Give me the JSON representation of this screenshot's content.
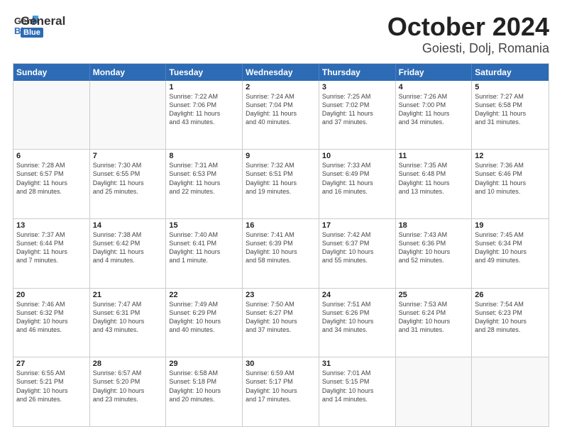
{
  "logo": {
    "text_general": "General",
    "text_blue": "Blue"
  },
  "title": "October 2024",
  "subtitle": "Goiesti, Dolj, Romania",
  "header_days": [
    "Sunday",
    "Monday",
    "Tuesday",
    "Wednesday",
    "Thursday",
    "Friday",
    "Saturday"
  ],
  "rows": [
    [
      {
        "day": "",
        "lines": [],
        "empty": true
      },
      {
        "day": "",
        "lines": [],
        "empty": true
      },
      {
        "day": "1",
        "lines": [
          "Sunrise: 7:22 AM",
          "Sunset: 7:06 PM",
          "Daylight: 11 hours",
          "and 43 minutes."
        ]
      },
      {
        "day": "2",
        "lines": [
          "Sunrise: 7:24 AM",
          "Sunset: 7:04 PM",
          "Daylight: 11 hours",
          "and 40 minutes."
        ]
      },
      {
        "day": "3",
        "lines": [
          "Sunrise: 7:25 AM",
          "Sunset: 7:02 PM",
          "Daylight: 11 hours",
          "and 37 minutes."
        ]
      },
      {
        "day": "4",
        "lines": [
          "Sunrise: 7:26 AM",
          "Sunset: 7:00 PM",
          "Daylight: 11 hours",
          "and 34 minutes."
        ]
      },
      {
        "day": "5",
        "lines": [
          "Sunrise: 7:27 AM",
          "Sunset: 6:58 PM",
          "Daylight: 11 hours",
          "and 31 minutes."
        ]
      }
    ],
    [
      {
        "day": "6",
        "lines": [
          "Sunrise: 7:28 AM",
          "Sunset: 6:57 PM",
          "Daylight: 11 hours",
          "and 28 minutes."
        ]
      },
      {
        "day": "7",
        "lines": [
          "Sunrise: 7:30 AM",
          "Sunset: 6:55 PM",
          "Daylight: 11 hours",
          "and 25 minutes."
        ]
      },
      {
        "day": "8",
        "lines": [
          "Sunrise: 7:31 AM",
          "Sunset: 6:53 PM",
          "Daylight: 11 hours",
          "and 22 minutes."
        ]
      },
      {
        "day": "9",
        "lines": [
          "Sunrise: 7:32 AM",
          "Sunset: 6:51 PM",
          "Daylight: 11 hours",
          "and 19 minutes."
        ]
      },
      {
        "day": "10",
        "lines": [
          "Sunrise: 7:33 AM",
          "Sunset: 6:49 PM",
          "Daylight: 11 hours",
          "and 16 minutes."
        ]
      },
      {
        "day": "11",
        "lines": [
          "Sunrise: 7:35 AM",
          "Sunset: 6:48 PM",
          "Daylight: 11 hours",
          "and 13 minutes."
        ]
      },
      {
        "day": "12",
        "lines": [
          "Sunrise: 7:36 AM",
          "Sunset: 6:46 PM",
          "Daylight: 11 hours",
          "and 10 minutes."
        ]
      }
    ],
    [
      {
        "day": "13",
        "lines": [
          "Sunrise: 7:37 AM",
          "Sunset: 6:44 PM",
          "Daylight: 11 hours",
          "and 7 minutes."
        ]
      },
      {
        "day": "14",
        "lines": [
          "Sunrise: 7:38 AM",
          "Sunset: 6:42 PM",
          "Daylight: 11 hours",
          "and 4 minutes."
        ]
      },
      {
        "day": "15",
        "lines": [
          "Sunrise: 7:40 AM",
          "Sunset: 6:41 PM",
          "Daylight: 11 hours",
          "and 1 minute."
        ]
      },
      {
        "day": "16",
        "lines": [
          "Sunrise: 7:41 AM",
          "Sunset: 6:39 PM",
          "Daylight: 10 hours",
          "and 58 minutes."
        ]
      },
      {
        "day": "17",
        "lines": [
          "Sunrise: 7:42 AM",
          "Sunset: 6:37 PM",
          "Daylight: 10 hours",
          "and 55 minutes."
        ]
      },
      {
        "day": "18",
        "lines": [
          "Sunrise: 7:43 AM",
          "Sunset: 6:36 PM",
          "Daylight: 10 hours",
          "and 52 minutes."
        ]
      },
      {
        "day": "19",
        "lines": [
          "Sunrise: 7:45 AM",
          "Sunset: 6:34 PM",
          "Daylight: 10 hours",
          "and 49 minutes."
        ]
      }
    ],
    [
      {
        "day": "20",
        "lines": [
          "Sunrise: 7:46 AM",
          "Sunset: 6:32 PM",
          "Daylight: 10 hours",
          "and 46 minutes."
        ]
      },
      {
        "day": "21",
        "lines": [
          "Sunrise: 7:47 AM",
          "Sunset: 6:31 PM",
          "Daylight: 10 hours",
          "and 43 minutes."
        ]
      },
      {
        "day": "22",
        "lines": [
          "Sunrise: 7:49 AM",
          "Sunset: 6:29 PM",
          "Daylight: 10 hours",
          "and 40 minutes."
        ]
      },
      {
        "day": "23",
        "lines": [
          "Sunrise: 7:50 AM",
          "Sunset: 6:27 PM",
          "Daylight: 10 hours",
          "and 37 minutes."
        ]
      },
      {
        "day": "24",
        "lines": [
          "Sunrise: 7:51 AM",
          "Sunset: 6:26 PM",
          "Daylight: 10 hours",
          "and 34 minutes."
        ]
      },
      {
        "day": "25",
        "lines": [
          "Sunrise: 7:53 AM",
          "Sunset: 6:24 PM",
          "Daylight: 10 hours",
          "and 31 minutes."
        ]
      },
      {
        "day": "26",
        "lines": [
          "Sunrise: 7:54 AM",
          "Sunset: 6:23 PM",
          "Daylight: 10 hours",
          "and 28 minutes."
        ]
      }
    ],
    [
      {
        "day": "27",
        "lines": [
          "Sunrise: 6:55 AM",
          "Sunset: 5:21 PM",
          "Daylight: 10 hours",
          "and 26 minutes."
        ]
      },
      {
        "day": "28",
        "lines": [
          "Sunrise: 6:57 AM",
          "Sunset: 5:20 PM",
          "Daylight: 10 hours",
          "and 23 minutes."
        ]
      },
      {
        "day": "29",
        "lines": [
          "Sunrise: 6:58 AM",
          "Sunset: 5:18 PM",
          "Daylight: 10 hours",
          "and 20 minutes."
        ]
      },
      {
        "day": "30",
        "lines": [
          "Sunrise: 6:59 AM",
          "Sunset: 5:17 PM",
          "Daylight: 10 hours",
          "and 17 minutes."
        ]
      },
      {
        "day": "31",
        "lines": [
          "Sunrise: 7:01 AM",
          "Sunset: 5:15 PM",
          "Daylight: 10 hours",
          "and 14 minutes."
        ]
      },
      {
        "day": "",
        "lines": [],
        "empty": true
      },
      {
        "day": "",
        "lines": [],
        "empty": true
      }
    ]
  ]
}
